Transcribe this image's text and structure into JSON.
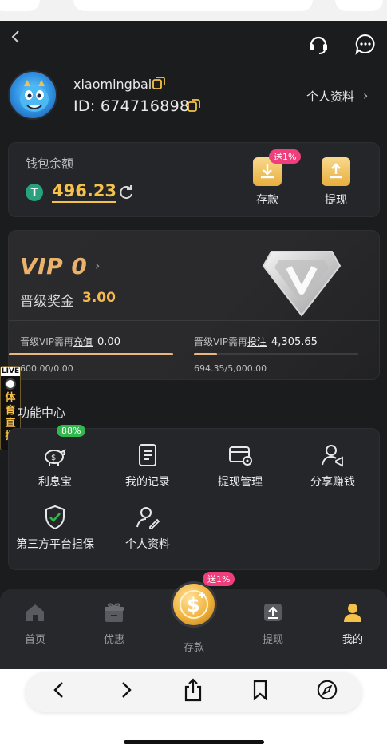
{
  "user": {
    "username": "xiaomingbai",
    "id_text": "ID: 674716898",
    "profile_link": "个人资料"
  },
  "wallet": {
    "label": "钱包余额",
    "currency_symbol": "T",
    "balance": "496.23",
    "deposit_label": "存款",
    "deposit_badge": "送1%",
    "withdraw_label": "提现"
  },
  "vip": {
    "title": "VIP 0",
    "bonus_label": "晋级奖金",
    "bonus_value": "3.00",
    "left_req_prefix": "晋级VIP需再",
    "left_req_link": "充值",
    "left_req_value": "0.00",
    "left_progress_text": "600.00/0.00",
    "left_progress_fraction": 1.0,
    "right_req_prefix": "晋级VIP需再",
    "right_req_link": "投注",
    "right_req_value": "4,305.65",
    "right_progress_text": "694.35/5,000.00",
    "right_progress_fraction": 0.139
  },
  "live_widget": {
    "tag": "LIVE",
    "text": "体育直播"
  },
  "functions": {
    "title": "功能中心",
    "items": [
      {
        "label": "利息宝",
        "badge": "88%",
        "icon": "piggy-bank-icon"
      },
      {
        "label": "我的记录",
        "icon": "document-icon"
      },
      {
        "label": "提现管理",
        "icon": "card-settings-icon"
      },
      {
        "label": "分享赚钱",
        "icon": "share-user-icon"
      },
      {
        "label": "第三方平台担保",
        "icon": "shield-check-icon"
      },
      {
        "label": "个人资料",
        "icon": "user-edit-icon"
      }
    ]
  },
  "tabbar": {
    "tabs": [
      {
        "label": "首页",
        "icon": "home-icon"
      },
      {
        "label": "优惠",
        "icon": "gift-icon"
      },
      {
        "label": "存款",
        "icon": "coin-icon",
        "badge": "送1%"
      },
      {
        "label": "提现",
        "icon": "upload-icon"
      },
      {
        "label": "我的",
        "icon": "user-icon",
        "active": true
      }
    ]
  },
  "colors": {
    "background": "#1b1c1e",
    "panel": "#25262a",
    "gold": "#f4c24a",
    "vip_gold": "#eab26a",
    "pink_badge": "#ee3f7c",
    "green_badge": "#31b84c"
  }
}
